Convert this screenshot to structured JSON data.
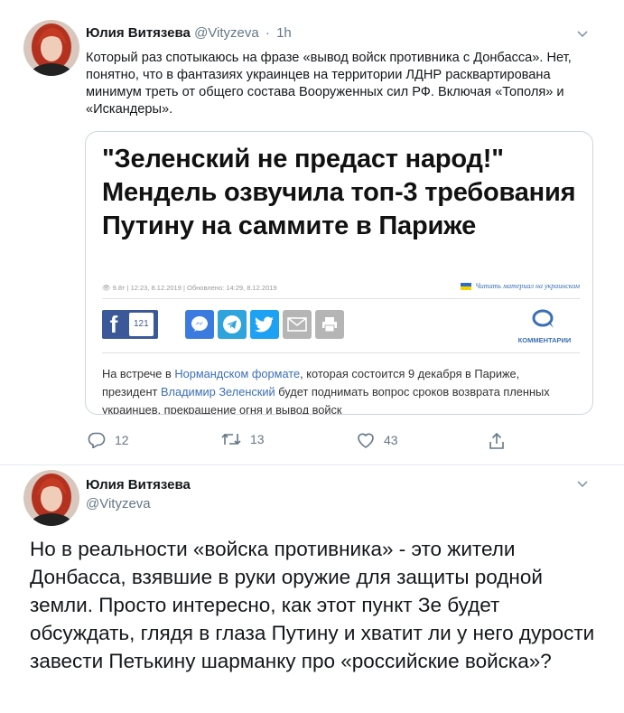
{
  "tweet1": {
    "author_name": "Юлия Витязева",
    "handle": "@Vityzeva",
    "separator": "·",
    "time": "1h",
    "text": "Который раз спотыкаюсь на фразе «вывод войск противника с Донбасса». Нет, понятно, что в фантазиях украинцев на территории ЛДНР расквартирована минимум треть от общего состава Вооруженных сил РФ. Включая «Тополя» и «Искандеры».",
    "card": {
      "headline": "\"Зеленский не предаст народ!\" Мендель озвучила топ-3 требования Путину на саммите в Париже",
      "meta": "👁 9.8т  |  12:23, 8.12.2019  |  Обновлено: 14:29, 8.12.2019",
      "ukr_link": "Читать материал на украинском",
      "fb_count": "121",
      "comments_label": "КОММЕНТАРИИ",
      "body_1": "На встрече в ",
      "body_link1": "Нормандском формате",
      "body_2": ", которая состоится 9 декабря в Париже, президент ",
      "body_link2": "Владимир Зеленский",
      "body_3": " будет поднимать вопрос сроков возврата пленных украинцев, прекращение огня и вывод войск"
    },
    "actions": {
      "replies": "12",
      "retweets": "13",
      "likes": "43"
    }
  },
  "tweet2": {
    "author_name": "Юлия Витязева",
    "handle": "@Vityzeva",
    "text": "Но в реальности «войска противника» - это жители Донбасса, взявшие в руки оружие для защиты родной земли. Просто интересно, как этот пункт Зе будет обсуждать, глядя в глаза Путину и хватит ли у него дурости завести Петькину шарманку про «российские войска»?"
  },
  "colors": {
    "link_blue": "#3b6fb5",
    "muted": "#657786",
    "facebook": "#3b5998",
    "twitter": "#1da1f2"
  }
}
